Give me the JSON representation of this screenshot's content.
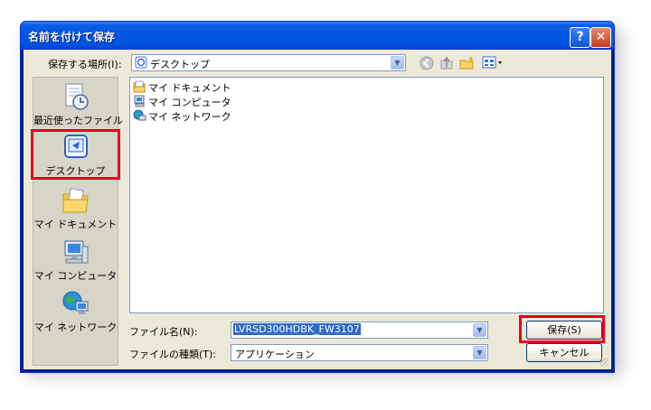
{
  "dialog": {
    "title": "名前を付けて保存",
    "help_button": "?",
    "close_button": "✕"
  },
  "location": {
    "label": "保存する場所(I):",
    "value": "デスクトップ"
  },
  "toolbar": {
    "back_icon": "back-icon",
    "up_icon": "up-folder-icon",
    "new_folder_icon": "new-folder-icon",
    "view_icon": "view-menu-icon"
  },
  "places": [
    {
      "label": "最近使ったファイル",
      "icon": "recent-files-icon"
    },
    {
      "label": "デスクトップ",
      "icon": "desktop-icon",
      "highlighted": true
    },
    {
      "label": "マイ ドキュメント",
      "icon": "my-documents-icon"
    },
    {
      "label": "マイ コンピュータ",
      "icon": "my-computer-icon"
    },
    {
      "label": "マイ ネットワーク",
      "icon": "my-network-icon"
    }
  ],
  "files": [
    {
      "name": "マイ ドキュメント",
      "icon": "documents-folder-icon"
    },
    {
      "name": "マイ コンピュータ",
      "icon": "computer-icon"
    },
    {
      "name": "マイ ネットワーク",
      "icon": "network-icon"
    }
  ],
  "filename": {
    "label": "ファイル名(N):",
    "value": "LVRSD300HDBK_FW3107"
  },
  "filetype": {
    "label": "ファイルの種類(T):",
    "value": "アプリケーション"
  },
  "buttons": {
    "save": "保存(S)",
    "cancel": "キャンセル"
  },
  "colors": {
    "title_bar": "#0454e3",
    "dialog_bg": "#ece9d8",
    "highlight_box": "#e8001c",
    "selection": "#316ac5"
  }
}
